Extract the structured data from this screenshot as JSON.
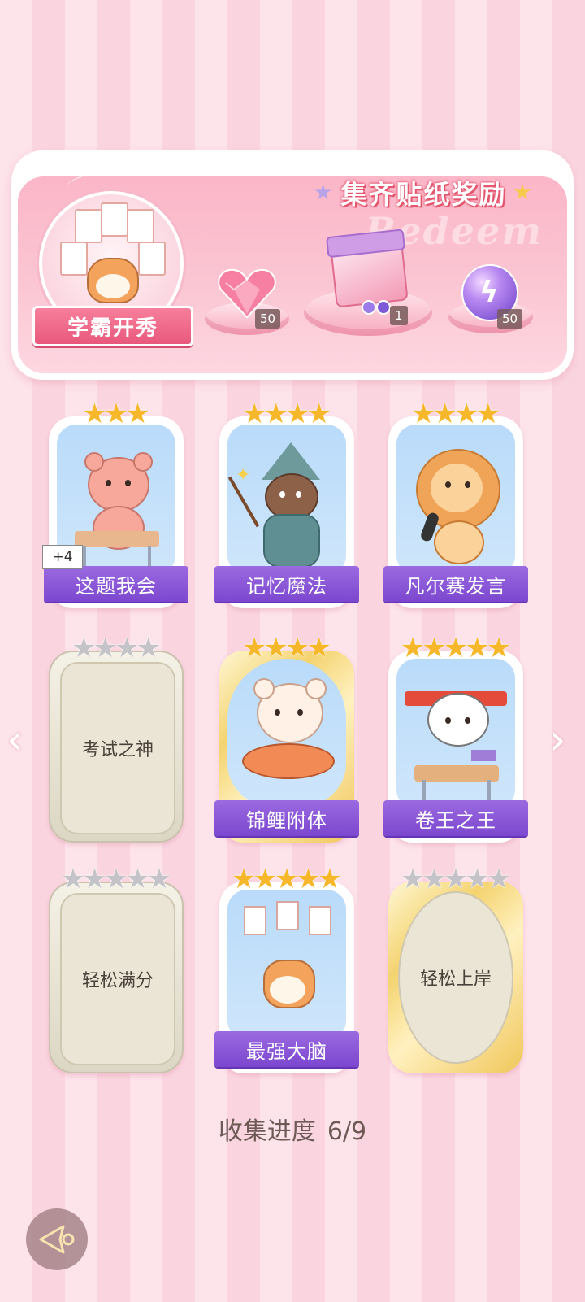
{
  "reward": {
    "title": "集齐贴纸奖励",
    "bg_text": "Redeem",
    "medal_label": "学霸开秀",
    "items": [
      {
        "icon": "pink-heart-gem-icon",
        "count": "50"
      },
      {
        "icon": "gift-box-icon",
        "count": "1"
      },
      {
        "icon": "lightning-orb-icon",
        "count": "50"
      }
    ]
  },
  "cards": [
    {
      "name": "这题我会",
      "stars_on": 3,
      "stars_total": 3,
      "collected": true,
      "frame": "white",
      "extra": "+4"
    },
    {
      "name": "记忆魔法",
      "stars_on": 4,
      "stars_total": 4,
      "collected": true,
      "frame": "white"
    },
    {
      "name": "凡尔赛发言",
      "stars_on": 4,
      "stars_total": 4,
      "collected": true,
      "frame": "white"
    },
    {
      "name": "考试之神",
      "stars_on": 0,
      "stars_total": 4,
      "collected": false,
      "frame": "beige"
    },
    {
      "name": "锦鲤附体",
      "stars_on": 4,
      "stars_total": 4,
      "collected": true,
      "frame": "gold"
    },
    {
      "name": "卷王之王",
      "stars_on": 5,
      "stars_total": 5,
      "collected": true,
      "frame": "white"
    },
    {
      "name": "轻松满分",
      "stars_on": 0,
      "stars_total": 5,
      "collected": false,
      "frame": "beige"
    },
    {
      "name": "最强大脑",
      "stars_on": 5,
      "stars_total": 5,
      "collected": true,
      "frame": "white"
    },
    {
      "name": "轻松上岸",
      "stars_on": 0,
      "stars_total": 5,
      "collected": false,
      "frame": "gold"
    }
  ],
  "progress": {
    "label": "收集进度",
    "value": "6/9"
  },
  "colors": {
    "accent": "#8b57d8",
    "star_gold": "#f6b72a",
    "bg_pink": "#fde3ea"
  }
}
